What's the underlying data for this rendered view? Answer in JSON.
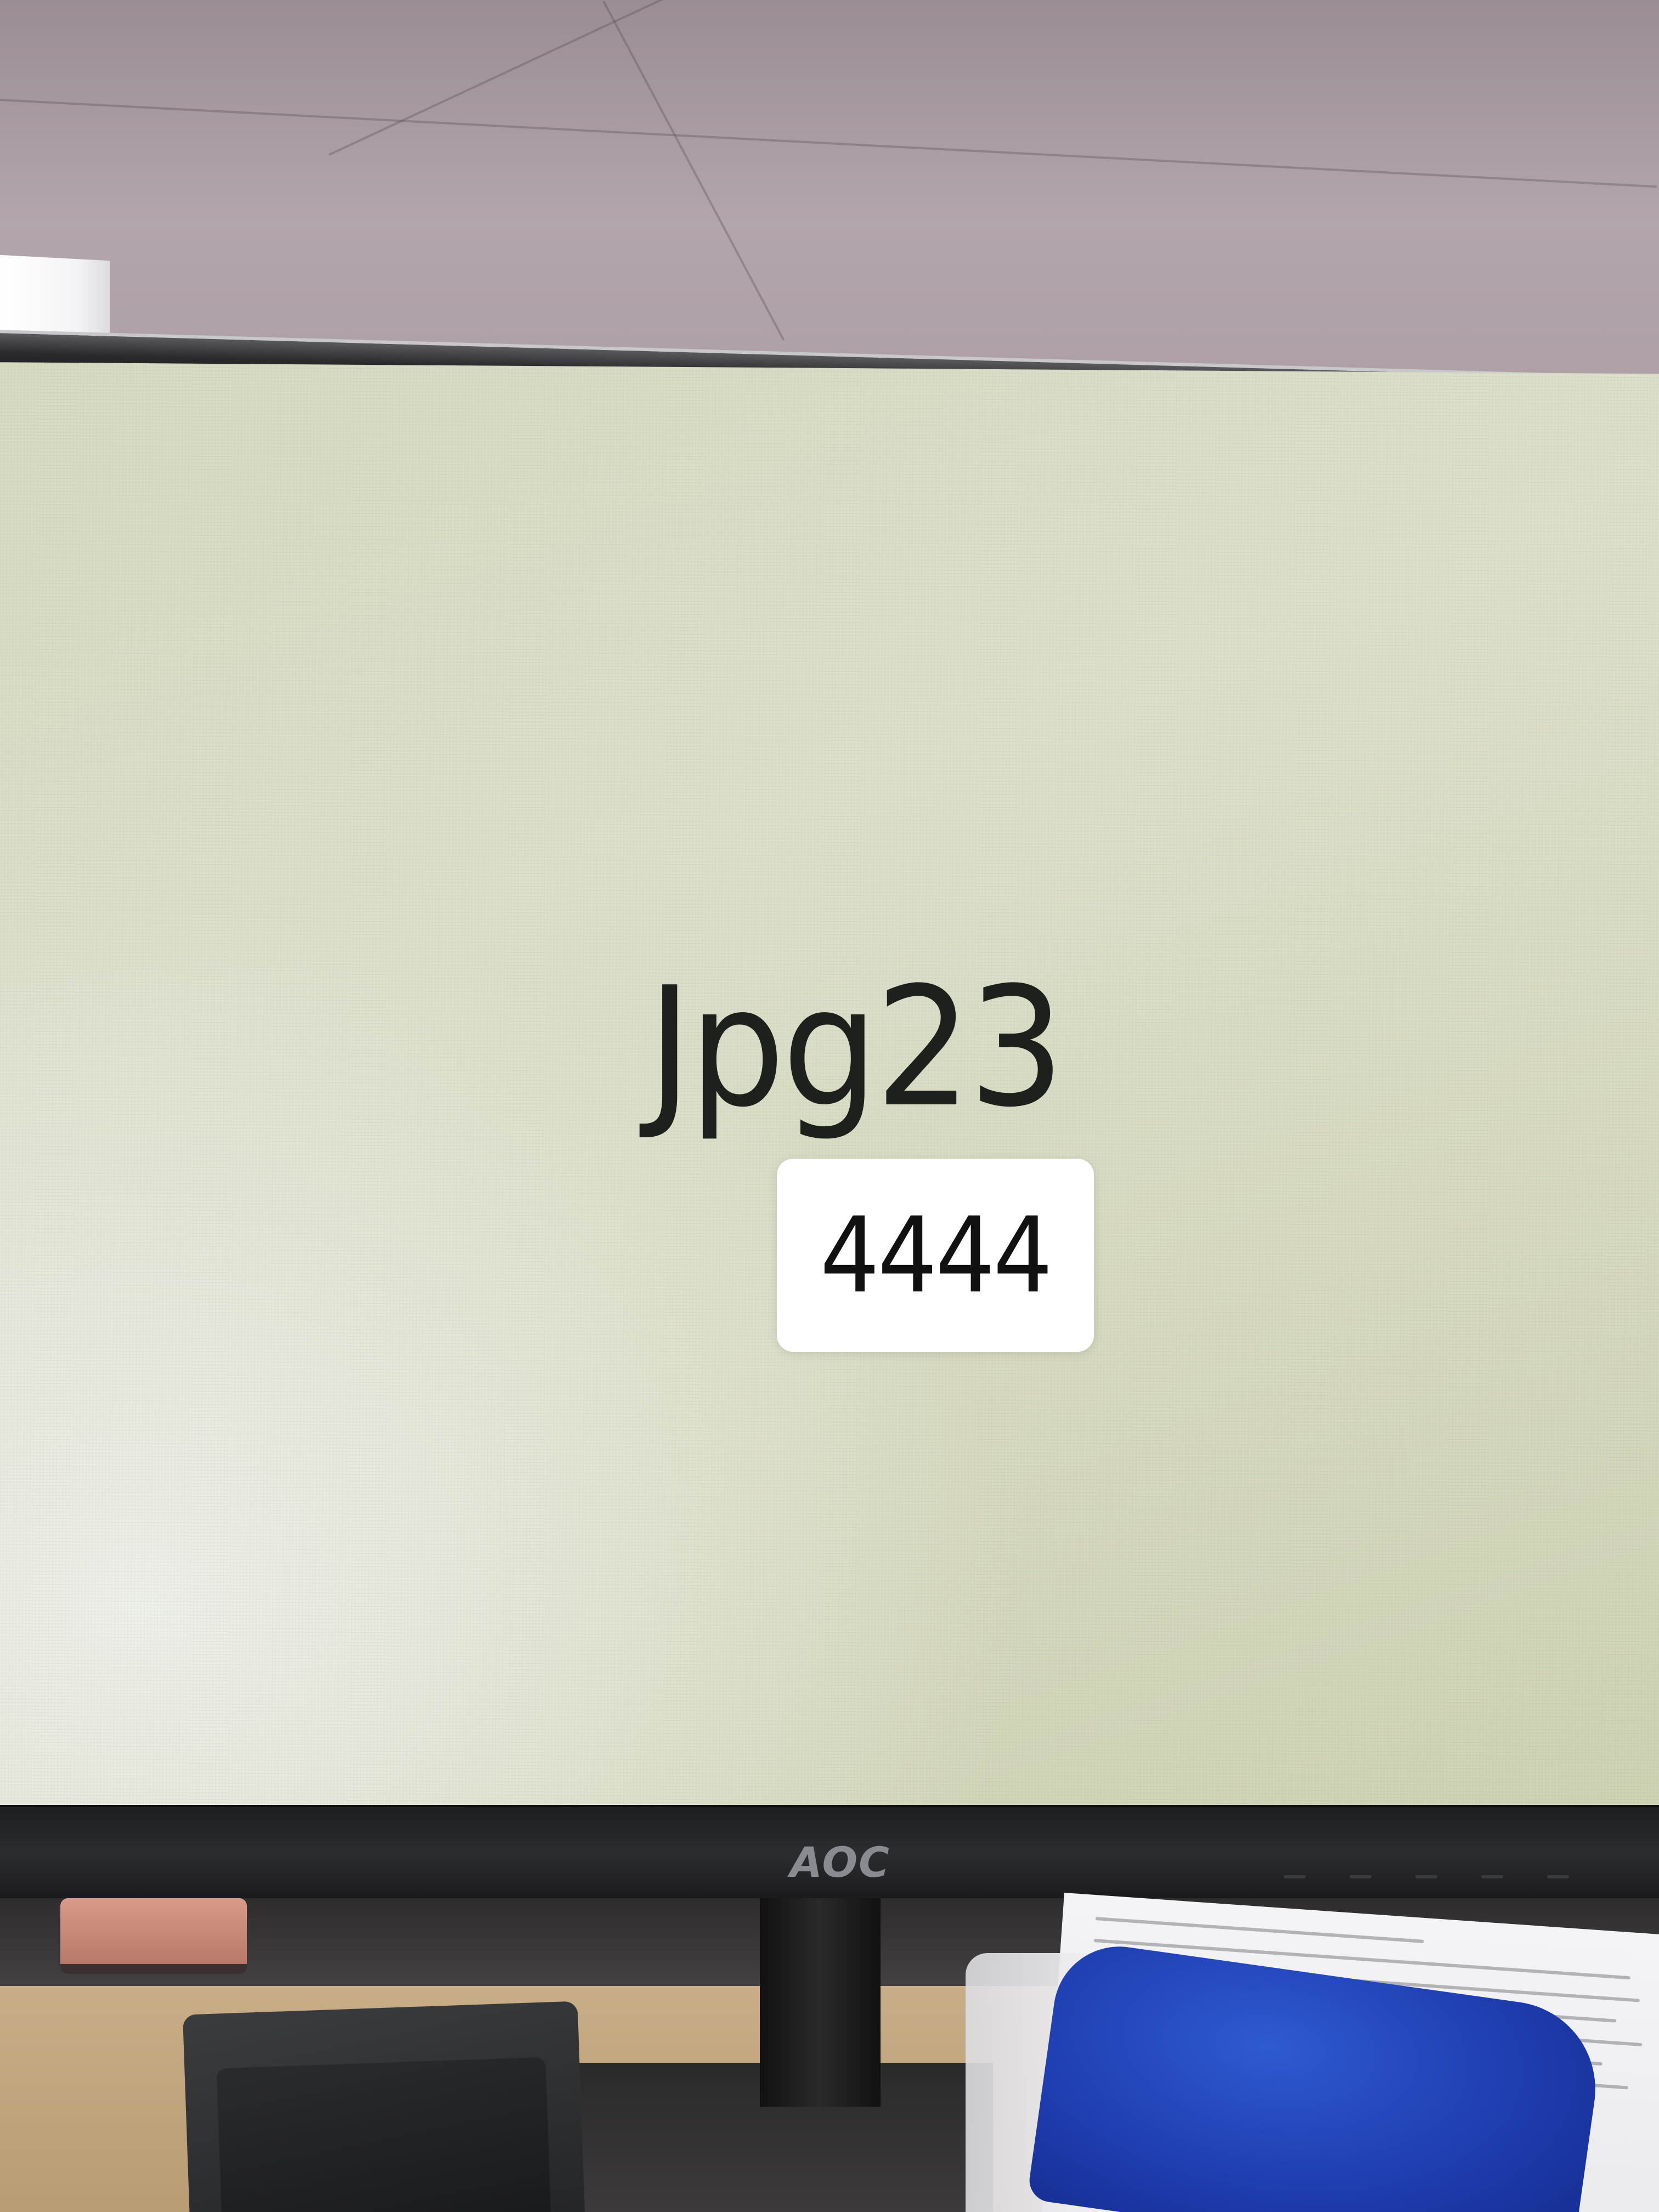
{
  "screen": {
    "title": "Jpg23",
    "code": "4444"
  },
  "monitor": {
    "brand": "AOC"
  },
  "colors": {
    "screen_background": "#d9dcc3",
    "title_text": "#1c211c",
    "code_box": "#ffffff",
    "bezel": "#1e1f21"
  }
}
